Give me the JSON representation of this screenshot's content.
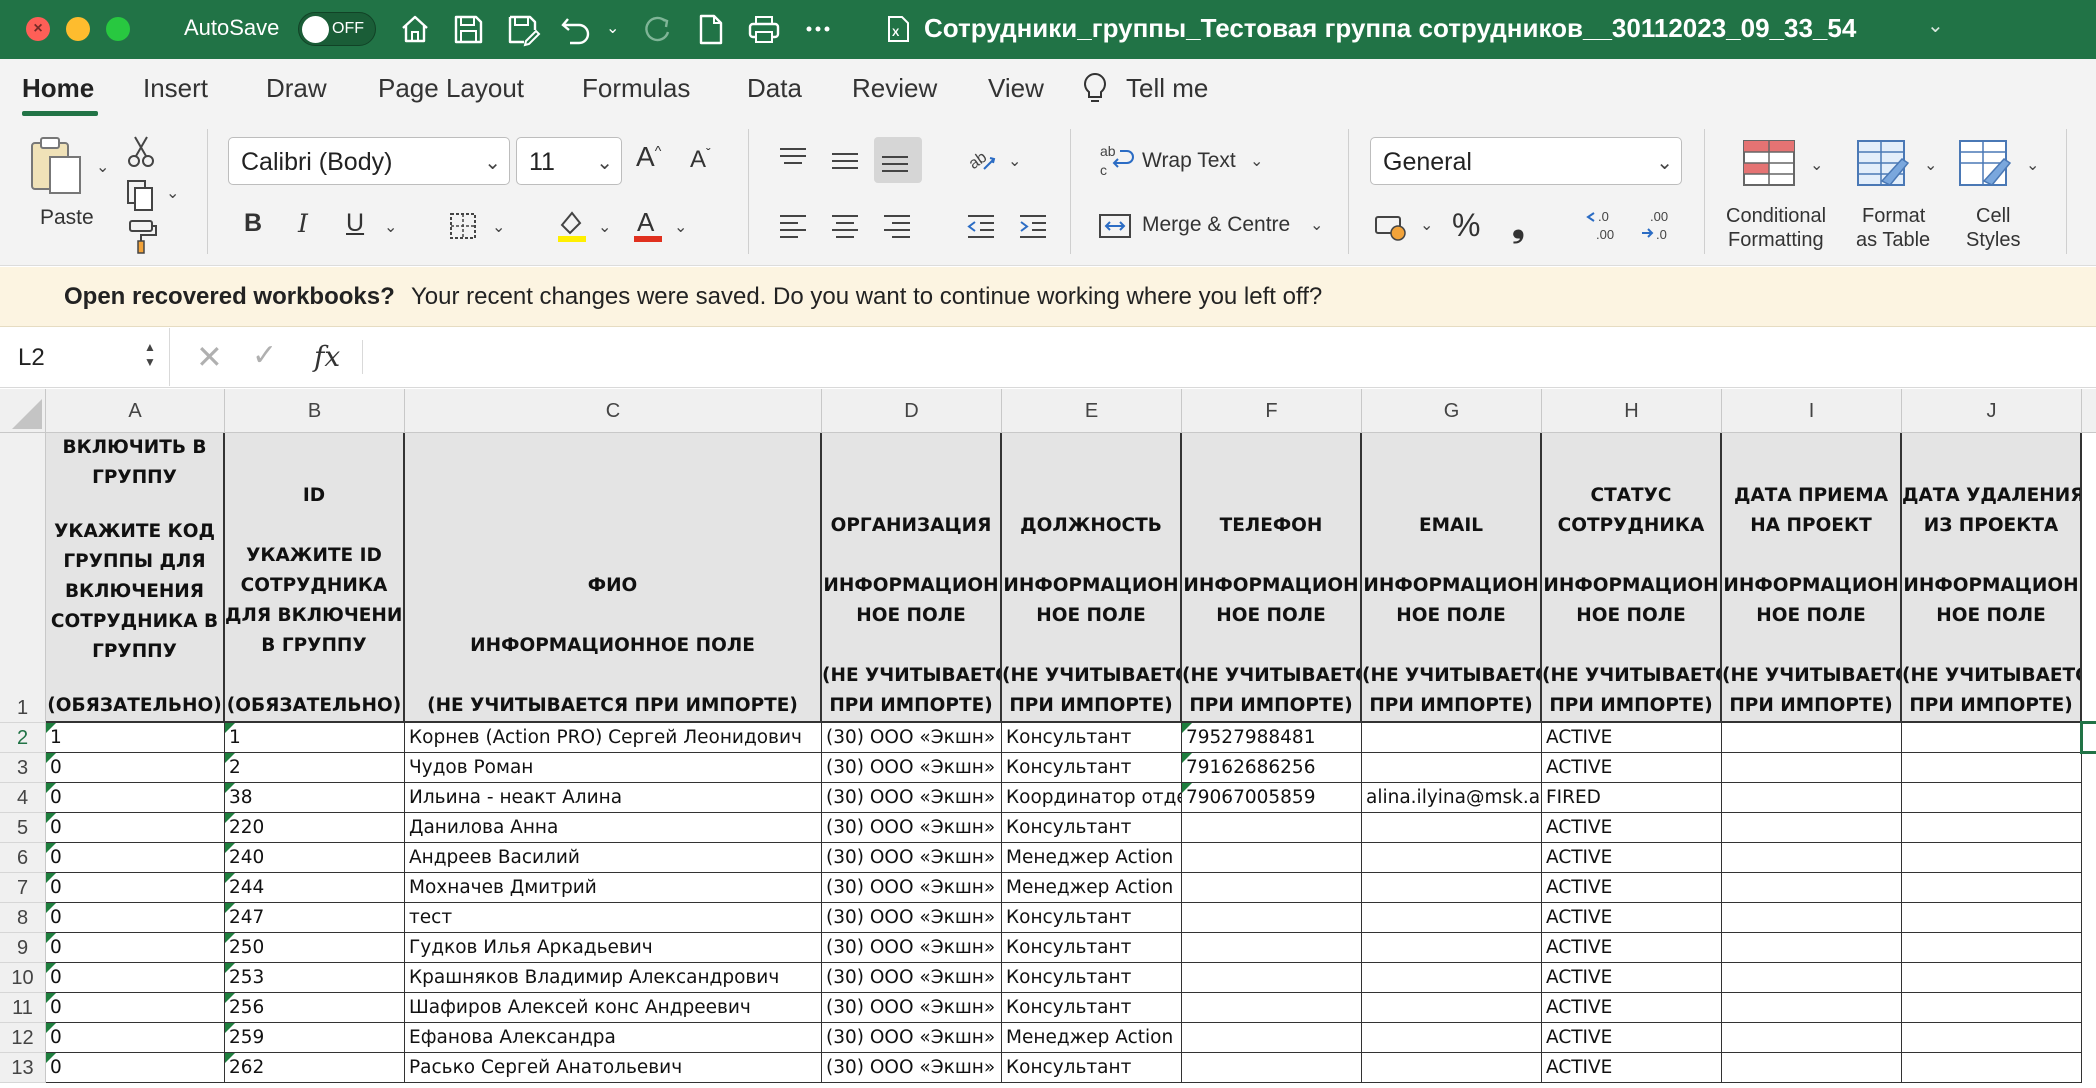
{
  "titlebar": {
    "autosave_label": "AutoSave",
    "autosave_state": "OFF",
    "document_title": "Сотрудники_группы_Тестовая группа сотрудников__30112023_09_33_54",
    "icons": [
      "home-icon",
      "save-icon",
      "save-as-icon",
      "undo-icon",
      "redo-icon",
      "new-file-icon",
      "print-icon",
      "more-icon"
    ]
  },
  "ribbon_tabs": [
    "Home",
    "Insert",
    "Draw",
    "Page Layout",
    "Formulas",
    "Data",
    "Review",
    "View",
    "Tell me"
  ],
  "ribbon": {
    "paste_label": "Paste",
    "font_name": "Calibri (Body)",
    "font_size": "11",
    "bold": "B",
    "italic": "I",
    "underline": "U",
    "wrap_text": "Wrap Text",
    "merge_centre": "Merge & Centre",
    "number_format": "General",
    "percent": "%",
    "comma": "❟",
    "conditional_formatting": [
      "Conditional",
      "Formatting"
    ],
    "format_as_table": [
      "Format",
      "as Table"
    ],
    "cell_styles": [
      "Cell",
      "Styles"
    ],
    "colors": {
      "highlight": "#ffef00",
      "font_color": "#e0301e",
      "accent": "#217346"
    }
  },
  "notification": {
    "question": "Open recovered workbooks?",
    "message": "Your recent changes were saved. Do you want to continue working where you left off?"
  },
  "formula_bar": {
    "name_box": "L2",
    "fx": "fx",
    "content": ""
  },
  "sheet": {
    "columns": [
      "A",
      "B",
      "C",
      "D",
      "E",
      "F",
      "G",
      "H",
      "I",
      "J"
    ],
    "header_row_number": "1",
    "header_cells": [
      [
        "ВКЛЮЧИТЬ В",
        "ГРУППУ",
        "",
        "УКАЖИТЕ КОД",
        "ГРУППЫ ДЛЯ",
        "ВКЛЮЧЕНИЯ",
        "СОТРУДНИКА В",
        "ГРУППУ",
        "",
        "(ОБЯЗАТЕЛЬНО)"
      ],
      [
        "ID",
        "",
        "УКАЖИТЕ ID",
        "СОТРУДНИКА",
        "ДЛЯ ВКЛЮЧЕНИЯ",
        "В ГРУППУ",
        "",
        "(ОБЯЗАТЕЛЬНО)"
      ],
      [
        "ФИО",
        "",
        "ИНФОРМАЦИОННОЕ ПОЛЕ",
        "",
        "(НЕ УЧИТЫВАЕТСЯ ПРИ ИМПОРТЕ)"
      ],
      [
        "ОРГАНИЗАЦИЯ",
        "",
        "ИНФОРМАЦИОН",
        "НОЕ ПОЛЕ",
        "",
        "(НЕ УЧИТЫВАЕТСЯ",
        "ПРИ ИМПОРТЕ)"
      ],
      [
        "ДОЛЖНОСТЬ",
        "",
        "ИНФОРМАЦИОН",
        "НОЕ ПОЛЕ",
        "",
        "(НЕ УЧИТЫВАЕТСЯ",
        "ПРИ ИМПОРТЕ)"
      ],
      [
        "ТЕЛЕФОН",
        "",
        "ИНФОРМАЦИОН",
        "НОЕ ПОЛЕ",
        "",
        "(НЕ УЧИТЫВАЕТСЯ",
        "ПРИ ИМПОРТЕ)"
      ],
      [
        "EMAIL",
        "",
        "ИНФОРМАЦИОН",
        "НОЕ ПОЛЕ",
        "",
        "(НЕ УЧИТЫВАЕТСЯ",
        "ПРИ ИМПОРТЕ)"
      ],
      [
        "СТАТУС",
        "СОТРУДНИКА",
        "",
        "ИНФОРМАЦИОН",
        "НОЕ ПОЛЕ",
        "",
        "(НЕ УЧИТЫВАЕТСЯ",
        "ПРИ ИМПОРТЕ)"
      ],
      [
        "ДАТА ПРИЕМА",
        "НА ПРОЕКТ",
        "",
        "ИНФОРМАЦИОН",
        "НОЕ ПОЛЕ",
        "",
        "(НЕ УЧИТЫВАЕТСЯ",
        "ПРИ ИМПОРТЕ)"
      ],
      [
        "ДАТА УДАЛЕНИЯ",
        "ИЗ ПРОЕКТА",
        "",
        "ИНФОРМАЦИОН",
        "НОЕ ПОЛЕ",
        "",
        "(НЕ УЧИТЫВАЕТСЯ",
        "ПРИ ИМПОРТЕ)"
      ]
    ],
    "rows": [
      {
        "row": "2",
        "cells": [
          "1",
          "1",
          "Корнев (Action PRO) Сергей Леонидович",
          "(30) ООО «Экшн»",
          "Консультант",
          "79527988481",
          "",
          "ACTIVE",
          "",
          ""
        ]
      },
      {
        "row": "3",
        "cells": [
          "0",
          "2",
          "Чудов Роман",
          "(30) ООО «Экшн»",
          "Консультант",
          "79162686256",
          "",
          "ACTIVE",
          "",
          ""
        ]
      },
      {
        "row": "4",
        "cells": [
          "0",
          "38",
          "Ильина - неакт Алина",
          "(30) ООО «Экшн»",
          "Координатор отде",
          "79067005859",
          "alina.ilyina@msk.a",
          "FIRED",
          "",
          ""
        ]
      },
      {
        "row": "5",
        "cells": [
          "0",
          "220",
          "Данилова Анна",
          "(30) ООО «Экшн»",
          "Консультант",
          "",
          "",
          "ACTIVE",
          "",
          ""
        ]
      },
      {
        "row": "6",
        "cells": [
          "0",
          "240",
          "Андреев Василий",
          "(30) ООО «Экшн»",
          "Менеджер Action",
          "",
          "",
          "ACTIVE",
          "",
          ""
        ]
      },
      {
        "row": "7",
        "cells": [
          "0",
          "244",
          "Мохначев Дмитрий",
          "(30) ООО «Экшн»",
          "Менеджер Action",
          "",
          "",
          "ACTIVE",
          "",
          ""
        ]
      },
      {
        "row": "8",
        "cells": [
          "0",
          "247",
          "тест",
          "(30) ООО «Экшн»",
          "Консультант",
          "",
          "",
          "ACTIVE",
          "",
          ""
        ]
      },
      {
        "row": "9",
        "cells": [
          "0",
          "250",
          "Гудков Илья Аркадьевич",
          "(30) ООО «Экшн»",
          "Консультант",
          "",
          "",
          "ACTIVE",
          "",
          ""
        ]
      },
      {
        "row": "10",
        "cells": [
          "0",
          "253",
          "Крашняков Владимир Александрович",
          "(30) ООО «Экшн»",
          "Консультант",
          "",
          "",
          "ACTIVE",
          "",
          ""
        ]
      },
      {
        "row": "11",
        "cells": [
          "0",
          "256",
          "Шафиров Алексей конс Андреевич",
          "(30) ООО «Экшн»",
          "Консультант",
          "",
          "",
          "ACTIVE",
          "",
          ""
        ]
      },
      {
        "row": "12",
        "cells": [
          "0",
          "259",
          "Ефанова Александра",
          "(30) ООО «Экшн»",
          "Менеджер Action",
          "",
          "",
          "ACTIVE",
          "",
          ""
        ]
      },
      {
        "row": "13",
        "cells": [
          "0",
          "262",
          "Расько Сергей Анатольевич",
          "(30) ООО «Экшн»",
          "Консультант",
          "",
          "",
          "ACTIVE",
          "",
          ""
        ]
      }
    ],
    "green_flag_columns": [
      "A",
      "B"
    ],
    "green_flag_f_rows": [
      "2",
      "3",
      "4"
    ]
  }
}
